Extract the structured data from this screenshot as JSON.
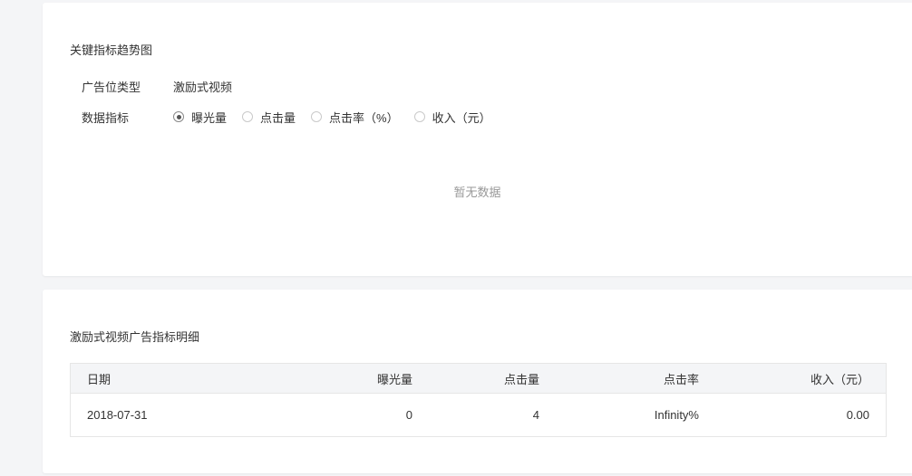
{
  "trend": {
    "title": "关键指标趋势图",
    "ad_type_label": "广告位类型",
    "ad_type_value": "激励式视频",
    "metric_label": "数据指标",
    "metric_options": [
      "曝光量",
      "点击量",
      "点击率（%）",
      "收入（元）"
    ],
    "selected_metric": "曝光量",
    "empty_text": "暂无数据"
  },
  "detail": {
    "title": "激励式视频广告指标明细",
    "columns": [
      "日期",
      "曝光量",
      "点击量",
      "点击率",
      "收入（元）"
    ],
    "rows": [
      [
        "2018-07-31",
        "0",
        "4",
        "Infinity%",
        "0.00"
      ]
    ]
  }
}
